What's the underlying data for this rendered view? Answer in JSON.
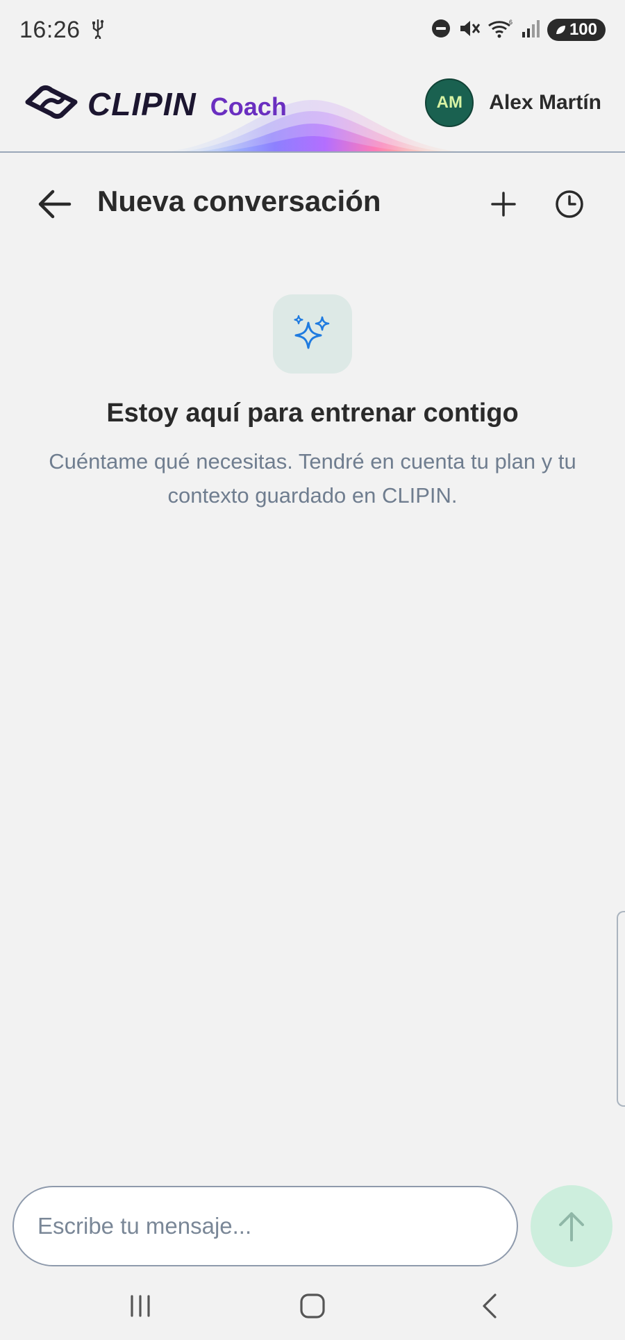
{
  "status_bar": {
    "time": "16:26",
    "battery": "100",
    "icons": [
      "usb-icon",
      "dnd-icon",
      "mute-icon",
      "wifi-icon",
      "signal-icon",
      "battery-icon"
    ]
  },
  "header": {
    "brand_name": "CLIPIN",
    "brand_sub": "Coach",
    "user": {
      "initials": "AM",
      "name": "Alex Martín"
    },
    "colors": {
      "brand_dark": "#1c1630",
      "brand_purple": "#6a2fc0",
      "avatar_bg": "#1a6150"
    }
  },
  "top_bar": {
    "title": "Nueva conversación",
    "icons": [
      "arrow-left-icon",
      "plus-icon",
      "clock-icon"
    ]
  },
  "empty_state": {
    "icon": "sparkles-icon",
    "title": "Estoy aquí para entrenar contigo",
    "description": "Cuéntame qué necesitas. Tendré en cuenta tu plan y tu contexto guardado en CLIPIN."
  },
  "composer": {
    "placeholder": "Escribe tu mensaje...",
    "value": "",
    "send_icon": "arrow-up-icon",
    "send_color": "#cdeedd"
  },
  "nav_bar": {
    "icons": [
      "recents-icon",
      "home-icon",
      "back-icon"
    ]
  }
}
